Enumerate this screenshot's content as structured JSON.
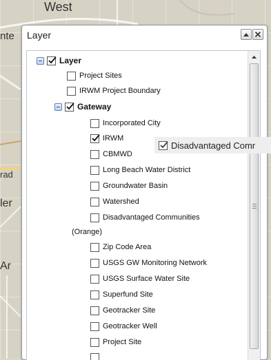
{
  "map": {
    "labels": {
      "west": "West",
      "nte": "nte",
      "rad": "rad",
      "ler": "ler",
      "ar": "Ar"
    }
  },
  "panel": {
    "title": "Layer"
  },
  "tree": {
    "root": {
      "label": "Layer",
      "checked": true
    },
    "root_children": [
      {
        "label": "Project Sites",
        "checked": false
      },
      {
        "label": "IRWM Project Boundary",
        "checked": false
      }
    ],
    "group": {
      "label": "Gateway",
      "checked": true
    },
    "group_children": [
      {
        "label": "Incorporated City",
        "checked": false
      },
      {
        "label": "IRWM",
        "checked": true
      },
      {
        "label": "CBMWD",
        "checked": false
      },
      {
        "label": "Long Beach Water District",
        "checked": false
      },
      {
        "label": "Groundwater Basin",
        "checked": false
      },
      {
        "label": "Watershed",
        "checked": false
      },
      {
        "label": "Disadvantaged Communities",
        "checked": false
      }
    ],
    "wrapped_note": "(Orange)",
    "group_children_2": [
      {
        "label": "Zip Code Area",
        "checked": false
      },
      {
        "label": "USGS GW Monitoring Network",
        "checked": false
      },
      {
        "label": "USGS Surface Water Site",
        "checked": false
      },
      {
        "label": "Superfund Site",
        "checked": false
      },
      {
        "label": "Geotracker Site",
        "checked": false
      },
      {
        "label": "Geotracker Well",
        "checked": false
      },
      {
        "label": "Project Site",
        "checked": false
      }
    ]
  },
  "tooltip": {
    "label": "Disadvantaged Comr",
    "checked": true
  }
}
